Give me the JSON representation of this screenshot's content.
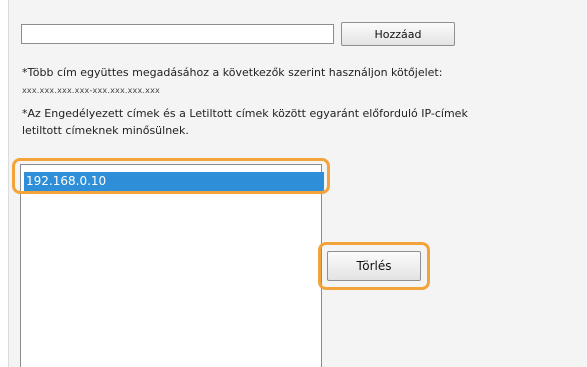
{
  "address_input": {
    "value": ""
  },
  "add_button": {
    "label": "Hozzáad"
  },
  "notes": {
    "multi_entry": "*Több cím együttes megadásához a következők szerint használjon kötőjelet:",
    "range_format": "xxx.xxx.xxx.xxx-xxx.xxx.xxx.xxx",
    "conflict": "*Az Engedélyezett címek és a Letiltott címek között egyaránt előforduló IP-címek",
    "conflict_cont": "letiltott címeknek minősülnek."
  },
  "address_list": {
    "items": [
      "192.168.0.10"
    ],
    "selected_index": 0
  },
  "delete_button": {
    "label": "Törlés"
  },
  "colors": {
    "highlight": "#f2a43a",
    "selection": "#2e8fd8"
  }
}
